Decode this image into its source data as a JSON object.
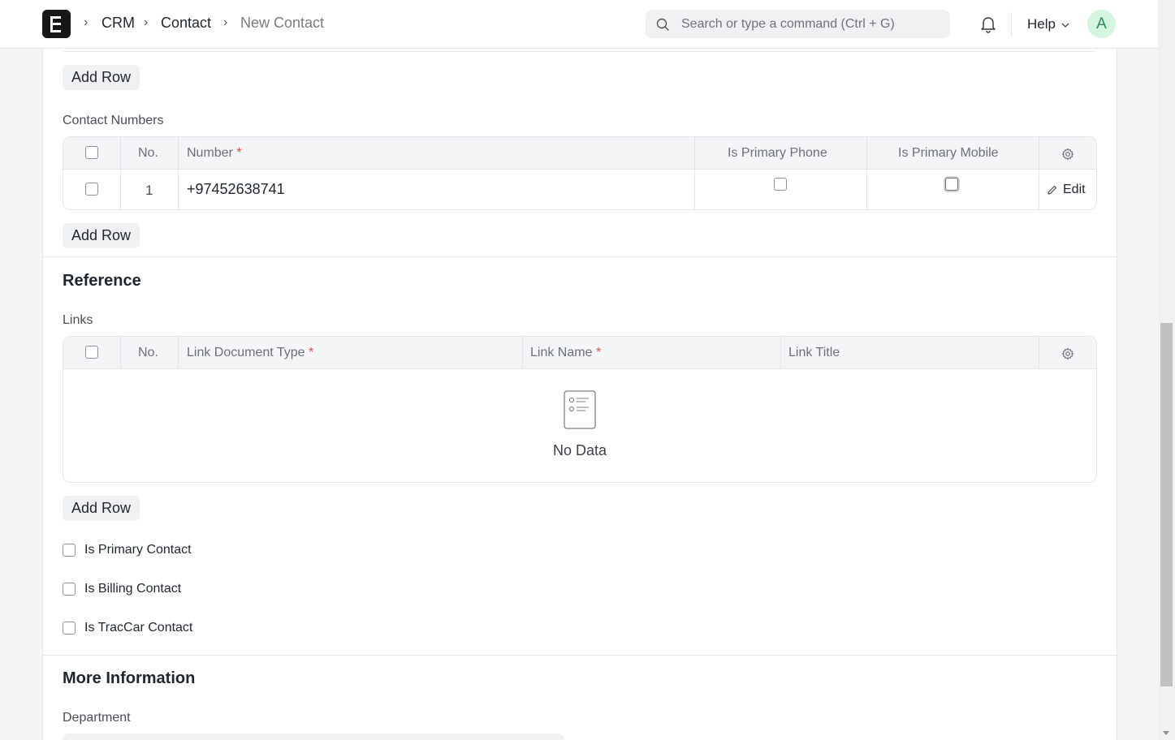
{
  "navbar": {
    "breadcrumbs": [
      "CRM",
      "Contact",
      "New Contact"
    ],
    "search_placeholder": "Search or type a command (Ctrl + G)",
    "help_label": "Help",
    "avatar_initial": "A"
  },
  "form": {
    "add_row_label": "Add Row",
    "contact_numbers": {
      "label": "Contact Numbers",
      "columns": {
        "no": "No.",
        "number": "Number",
        "is_primary_phone": "Is Primary Phone",
        "is_primary_mobile": "Is Primary Mobile"
      },
      "required_mark": "*",
      "rows": [
        {
          "no": "1",
          "number": "+97452638741",
          "is_primary_phone": false,
          "is_primary_mobile": false
        }
      ],
      "edit_label": "Edit"
    },
    "reference": {
      "title": "Reference",
      "links_label": "Links",
      "columns": {
        "no": "No.",
        "link_document_type": "Link Document Type",
        "link_name": "Link Name",
        "link_title": "Link Title"
      },
      "empty_text": "No Data"
    },
    "checkboxes": {
      "is_primary_contact": "Is Primary Contact",
      "is_billing_contact": "Is Billing Contact",
      "is_traccar_contact": "Is TracCar Contact"
    },
    "more_information": {
      "title": "More Information",
      "department_label": "Department"
    }
  }
}
